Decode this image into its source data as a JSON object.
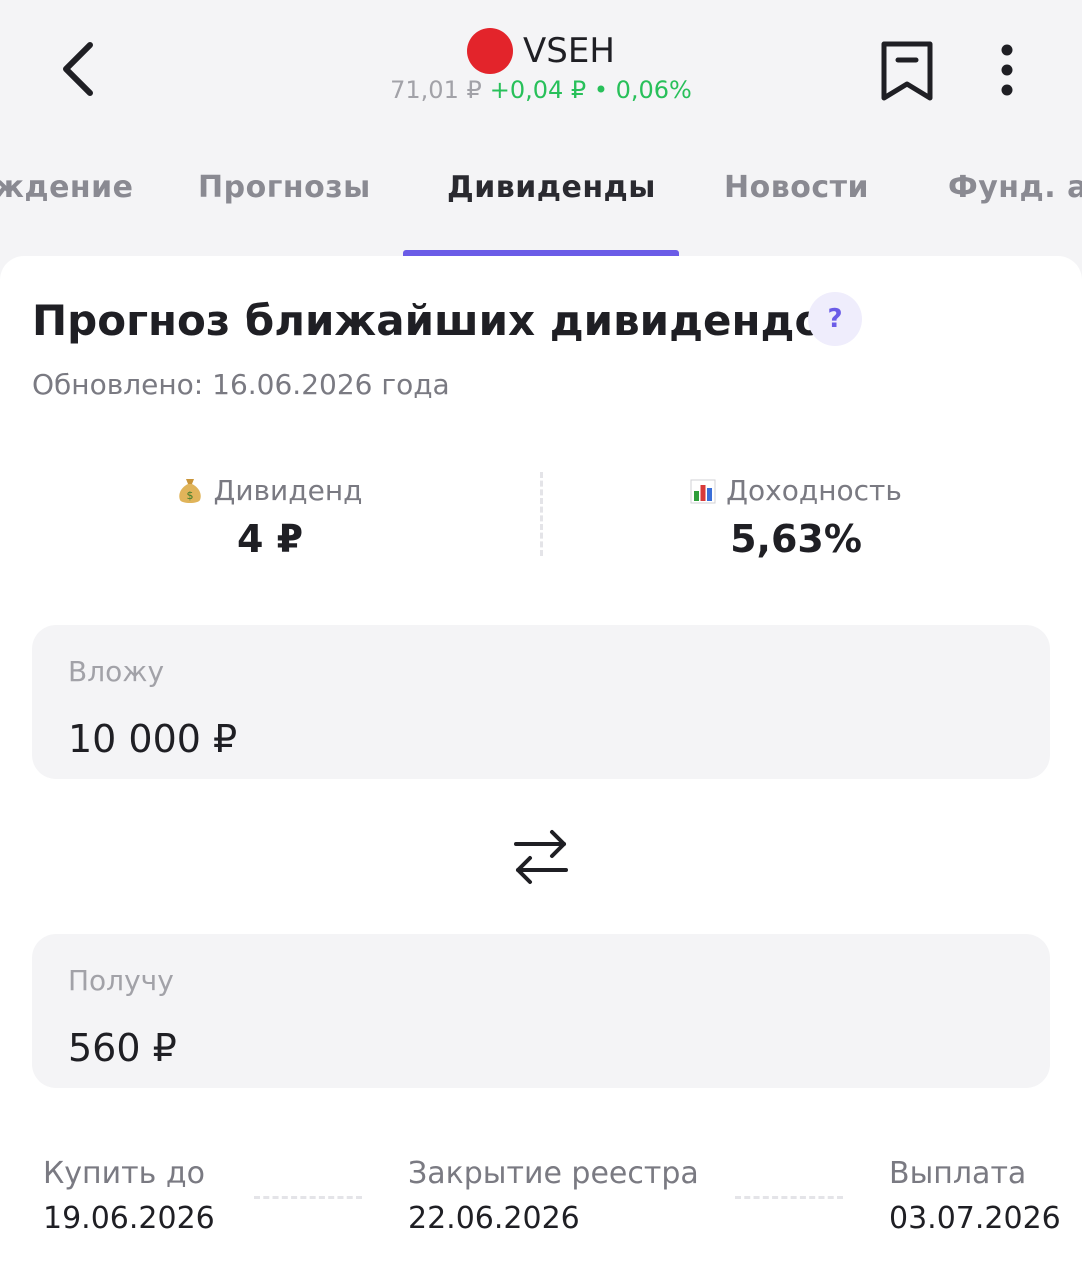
{
  "header": {
    "ticker": "VSEH",
    "price": "71,01 ₽",
    "change": "+0,04 ₽ • 0,06%",
    "colors": {
      "accent": "#6b5ce7",
      "positive": "#28c05a",
      "logo": "#e3242b"
    }
  },
  "tabs": [
    {
      "label": "ждение"
    },
    {
      "label": "Прогнозы"
    },
    {
      "label": "Дивиденды",
      "active": true
    },
    {
      "label": "Новости"
    },
    {
      "label": "Фунд. ан"
    }
  ],
  "section": {
    "title": "Прогноз ближайших дивидендов",
    "help": "?",
    "updated": "Обновлено: 16.06.2026 года"
  },
  "stats": {
    "dividend": {
      "icon": "money-bag-icon",
      "label": "Дивиденд",
      "value": "4 ₽"
    },
    "yield": {
      "icon": "bar-chart-icon",
      "label": "Доходность",
      "value": "5,63%"
    }
  },
  "calculator": {
    "invest": {
      "label": "Вложу",
      "value": "10 000 ₽"
    },
    "receive": {
      "label": "Получу",
      "value": "560 ₽"
    }
  },
  "dates": {
    "buy_before": {
      "label": "Купить до",
      "value": "19.06.2026"
    },
    "registry_close": {
      "label": "Закрытие реестра",
      "value": "22.06.2026"
    },
    "payout": {
      "label": "Выплата",
      "value": "03.07.2026"
    }
  }
}
